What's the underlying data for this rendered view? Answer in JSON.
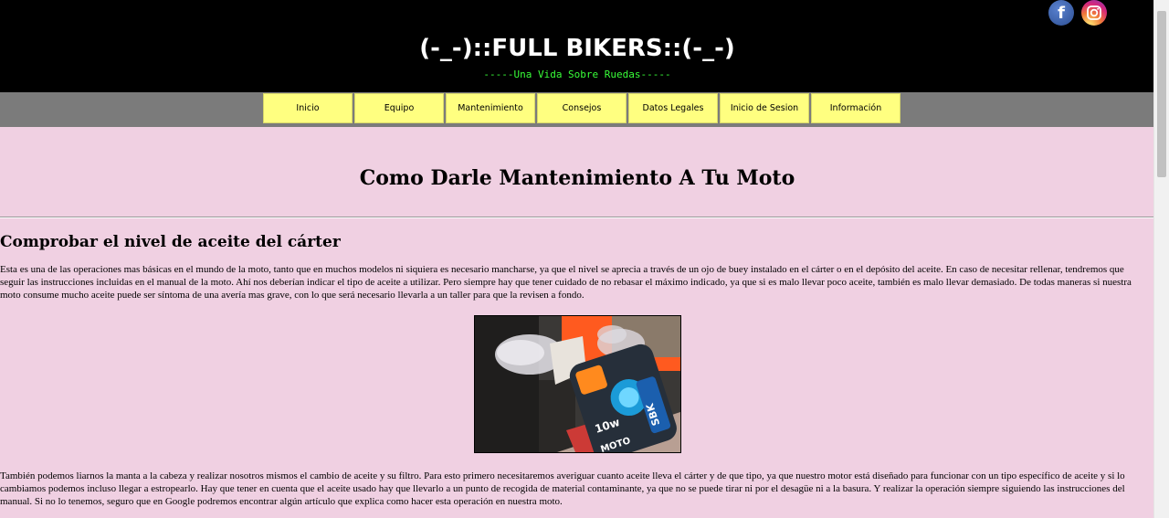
{
  "header": {
    "title": "(-_-)::FULL BIKERS::(-_-)",
    "subtitle": "-----Una Vida Sobre Ruedas-----",
    "social": [
      {
        "icon": "facebook-icon",
        "glyph": "f"
      },
      {
        "icon": "instagram-icon"
      }
    ]
  },
  "nav": {
    "items": [
      "Inicio",
      "Equipo",
      "Mantenimiento",
      "Consejos",
      "Datos Legales",
      "Inicio de Sesion",
      "Información"
    ]
  },
  "main": {
    "title": "Como Darle Mantenimiento A Tu Moto",
    "section_title": "Comprobar el nivel de aceite del cárter",
    "paragraph1": "Esta es una de las operaciones mas básicas en el mundo de la moto, tanto que en muchos modelos ni siquiera es necesario mancharse, ya que el nivel se aprecia a través de un ojo de buey instalado en el cárter o en el depósito del aceite. En caso de necesitar rellenar, tendremos que seguir las instrucciones incluidas en el manual de la moto. Ahí nos deberían indicar el tipo de aceite a utilizar. Pero siempre hay que tener cuidado de no rebasar el máximo indicado, ya que si es malo llevar poco aceite, también es malo llevar demasiado. De todas maneras si nuestra moto consume mucho aceite puede ser síntoma de una avería mas grave, con lo que será necesario llevarla a un taller para que la revisen a fondo.",
    "photo": {
      "bottle_label": "SBK",
      "bottle_text": "10w",
      "brand_text": "MOTO"
    },
    "paragraph2": "También podemos liarnos la manta a la cabeza y realizar nosotros mismos el cambio de aceite y su filtro. Para esto primero necesitaremos averiguar cuanto aceite lleva el cárter y de que tipo, ya que nuestro motor está diseñado para funcionar con un tipo específico de aceite y si lo cambiamos podemos incluso llegar a estropearlo. Hay que tener en cuenta que el aceite usado hay que llevarlo a un punto de recogida de material contaminante, ya que no se puede tirar ni por el desagüe ni a la basura. Y realizar la operación siempre siguiendo las instrucciones del manual. Si no lo tenemos, seguro que en Google podremos encontrar algún artículo que explica como hacer esta operación en nuestra moto."
  },
  "colors": {
    "background": "#f0d0e2",
    "header_bg": "#000000",
    "subtitle": "#39ff39",
    "nav_bg": "#7b7b7b",
    "nav_item": "#ffff80"
  }
}
